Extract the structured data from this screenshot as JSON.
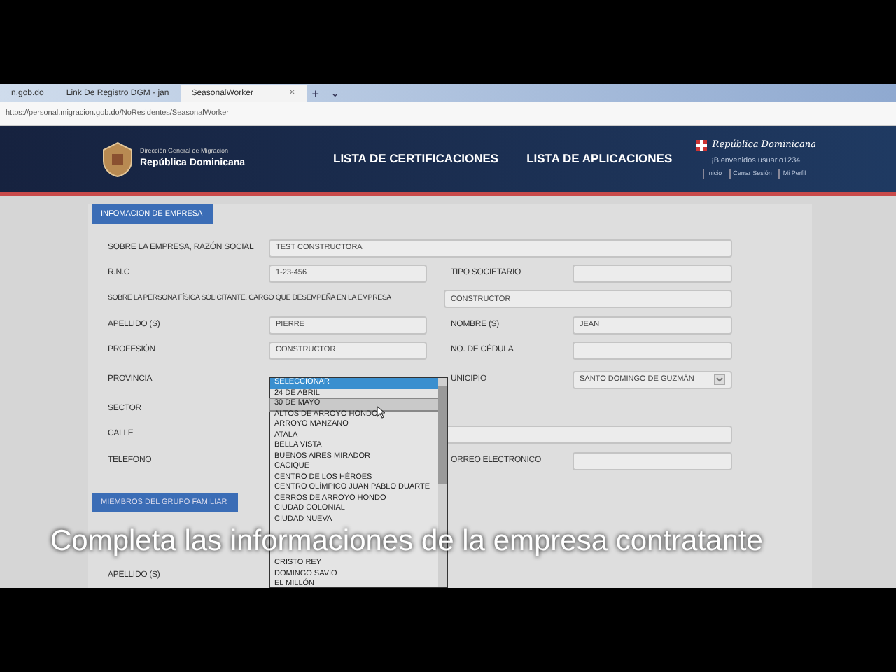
{
  "browser": {
    "tabs": [
      {
        "label": "n.gob.do",
        "selected": false
      },
      {
        "label": "Link De Registro DGM - jan",
        "selected": false
      },
      {
        "label": "SeasonalWorker",
        "selected": true
      }
    ],
    "close_tab": "×",
    "new_tab": "+",
    "tab_menu": "⌄",
    "url": "https://personal.migracion.gob.do/NoResidentes/SeasonalWorker"
  },
  "header": {
    "org_line": "Dirección General de Migración",
    "org_name": "República Dominicana",
    "nav": [
      "LISTA DE CERTIFICACIONES",
      "LISTA DE APLICACIONES"
    ],
    "brand": "República Dominicana",
    "welcome": "¡Bienvenidos usuario1234",
    "links": [
      "Inicio",
      "Cerrar Sesión",
      "Mi Perfil"
    ]
  },
  "section": "INFOMACION DE EMPRESA",
  "rows": [
    {
      "left": {
        "label": "SOBRE LA EMPRESA, RAZÓN SOCIAL",
        "value": "TEST CONSTRUCTORA",
        "kind": "wide"
      }
    },
    {
      "left": {
        "label": "R.N.C",
        "value": "1-23-456",
        "kind": "text"
      },
      "right": {
        "label": "TIPO SOCIETARIO",
        "kind": "text"
      }
    },
    {
      "left": {
        "label": "SOBRE LA PERSONA FÍSICA SOLICITANTE, CARGO QUE DESEMPEÑA EN LA EMPRESA",
        "value": "CONSTRUCTOR",
        "kind": "long-label"
      }
    },
    {
      "left": {
        "label": "APELLIDO (S)",
        "value": "PIERRE",
        "kind": "text"
      },
      "right": {
        "label": "NOMBRE (S)",
        "value": "JEAN",
        "kind": "text"
      }
    },
    {
      "left": {
        "label": "PROFESIÓN",
        "value": "CONSTRUCTOR",
        "kind": "text"
      },
      "right": {
        "label": "NO. DE CÉDULA",
        "kind": "text"
      }
    },
    {
      "left": {
        "label": "PROVINCIA",
        "kind": "covered"
      },
      "right": {
        "label": "UNICIPIO",
        "value": "SANTO DOMINGO DE GUZMÁN",
        "kind": "select"
      }
    },
    {
      "left": {
        "label": "SECTOR",
        "kind": "covered"
      }
    },
    {
      "left": {
        "label": "CALLE",
        "kind": "wide"
      }
    },
    {
      "left": {
        "label": "TELEFONO",
        "kind": "covered"
      },
      "right": {
        "label": "ORREO ELECTRONICO",
        "kind": "text"
      }
    }
  ],
  "dropdown": {
    "options": [
      {
        "label": "SELECCIONAR",
        "selected": true,
        "hovered": false
      },
      {
        "label": "24 DE ABRIL",
        "selected": false,
        "hovered": false
      },
      {
        "label": "30 DE MAYO",
        "selected": false,
        "hovered": true
      },
      {
        "label": "ALTOS DE ARROYO HONDO",
        "selected": false,
        "hovered": false
      },
      {
        "label": "ARROYO MANZANO",
        "selected": false,
        "hovered": false
      },
      {
        "label": "ATALA",
        "selected": false,
        "hovered": false
      },
      {
        "label": "BELLA VISTA",
        "selected": false,
        "hovered": false
      },
      {
        "label": "BUENOS AIRES MIRADOR",
        "selected": false,
        "hovered": false
      },
      {
        "label": "CACIQUE",
        "selected": false,
        "hovered": false
      },
      {
        "label": "CENTRO DE LOS HÉROES",
        "selected": false,
        "hovered": false
      },
      {
        "label": "CENTRO OLÍMPICO JUAN PABLO DUARTE",
        "selected": false,
        "hovered": false
      },
      {
        "label": "CERROS DE ARROYO HONDO",
        "selected": false,
        "hovered": false
      },
      {
        "label": "CIUDAD COLONIAL",
        "selected": false,
        "hovered": false
      },
      {
        "label": "CIUDAD NUEVA",
        "selected": false,
        "hovered": false
      }
    ],
    "more_options": [
      {
        "label": "CRISTO REY",
        "selected": false,
        "hovered": false
      },
      {
        "label": "DOMINGO SAVIO",
        "selected": false,
        "hovered": false
      },
      {
        "label": "EL MILLÓN",
        "selected": false,
        "hovered": false
      }
    ]
  },
  "family_section": "MIEMBROS DEL GRUPO FAMILIAR",
  "family_label": "APELLIDO (S)",
  "caption": "Completa las informaciones de la empresa contratante"
}
